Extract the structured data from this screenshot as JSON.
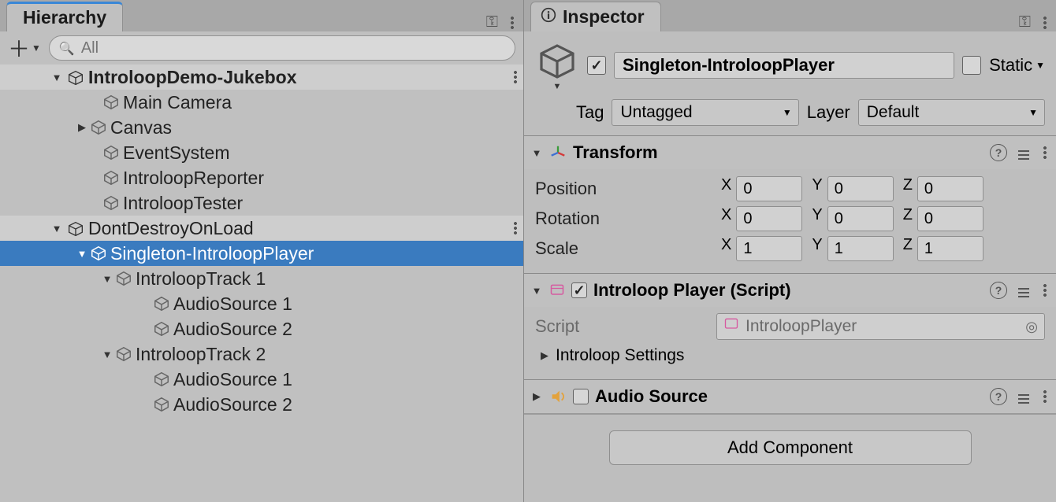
{
  "hierarchy": {
    "tab_title": "Hierarchy",
    "search_placeholder": "All",
    "scenes": {
      "scene1": "IntroloopDemo-Jukebox",
      "scene2": "DontDestroyOnLoad"
    },
    "items": {
      "main_camera": "Main Camera",
      "canvas": "Canvas",
      "event_system": "EventSystem",
      "introloop_reporter": "IntroloopReporter",
      "introloop_tester": "IntroloopTester",
      "singleton": "Singleton-IntroloopPlayer",
      "track1": "IntroloopTrack 1",
      "audio1a": "AudioSource 1",
      "audio1b": "AudioSource 2",
      "track2": "IntroloopTrack 2",
      "audio2a": "AudioSource 1",
      "audio2b": "AudioSource 2"
    }
  },
  "inspector": {
    "tab_title": "Inspector",
    "name": "Singleton-IntroloopPlayer",
    "static_label": "Static",
    "tag_label": "Tag",
    "tag_value": "Untagged",
    "layer_label": "Layer",
    "layer_value": "Default",
    "transform": {
      "title": "Transform",
      "position_label": "Position",
      "rotation_label": "Rotation",
      "scale_label": "Scale",
      "labels": {
        "x": "X",
        "y": "Y",
        "z": "Z"
      },
      "position": {
        "x": "0",
        "y": "0",
        "z": "0"
      },
      "rotation": {
        "x": "0",
        "y": "0",
        "z": "0"
      },
      "scale": {
        "x": "1",
        "y": "1",
        "z": "1"
      }
    },
    "introloop_player": {
      "title": "Introloop Player (Script)",
      "script_label": "Script",
      "script_value": "IntroloopPlayer",
      "settings_label": "Introloop Settings"
    },
    "audio_source": {
      "title": "Audio Source"
    },
    "add_component": "Add Component"
  }
}
